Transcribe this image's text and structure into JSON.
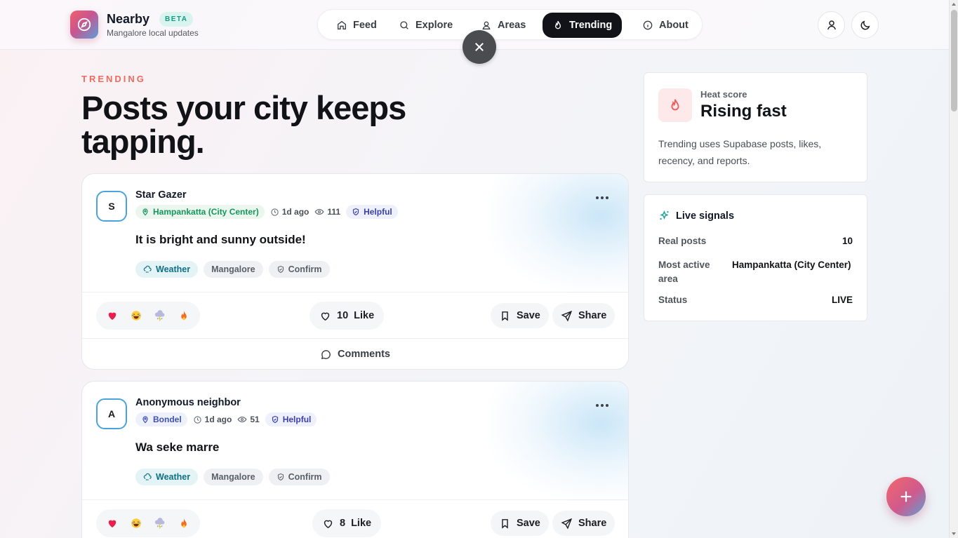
{
  "brand": {
    "name": "Nearby",
    "badge": "BETA",
    "subtitle": "Mangalore local updates"
  },
  "nav": [
    {
      "label": "Feed",
      "icon": "home-icon"
    },
    {
      "label": "Explore",
      "icon": "search-icon"
    },
    {
      "label": "Areas",
      "icon": "map-pin-user-icon"
    },
    {
      "label": "Trending",
      "icon": "flame-icon",
      "active": true
    },
    {
      "label": "About",
      "icon": "info-icon"
    }
  ],
  "hero": {
    "eyebrow": "TRENDING",
    "title": "Posts your city keeps tapping."
  },
  "posts": [
    {
      "avatar": "S",
      "author": "Star Gazer",
      "location": "Hampankatta (City Center)",
      "time": "1d ago",
      "views": "111",
      "badge": "Helpful",
      "text": "It is bright and sunny outside!",
      "tags": [
        "Weather",
        "Mangalore",
        "Confirm"
      ],
      "likes": "10",
      "like_label": "Like",
      "save_label": "Save",
      "share_label": "Share",
      "comments_label": "Comments"
    },
    {
      "avatar": "A",
      "author": "Anonymous neighbor",
      "location": "Bondel",
      "time": "1d ago",
      "views": "51",
      "badge": "Helpful",
      "text": "Wa seke marre",
      "tags": [
        "Weather",
        "Mangalore",
        "Confirm"
      ],
      "likes": "8",
      "like_label": "Like",
      "save_label": "Save",
      "share_label": "Share"
    }
  ],
  "heat": {
    "label": "Heat score",
    "value": "Rising fast",
    "description": "Trending uses Supabase posts, likes, recency, and reports."
  },
  "signals": {
    "title": "Live signals",
    "rows": [
      {
        "label": "Real posts",
        "value": "10"
      },
      {
        "label": "Most active area",
        "value": "Hampankatta (City Center)"
      },
      {
        "label": "Status",
        "value": "LIVE"
      }
    ]
  },
  "colors": {
    "accent": "#ef6a5e",
    "active_nav": "#111318",
    "location_green": "#16965c",
    "helpful_blue": "#3b3fb0"
  }
}
